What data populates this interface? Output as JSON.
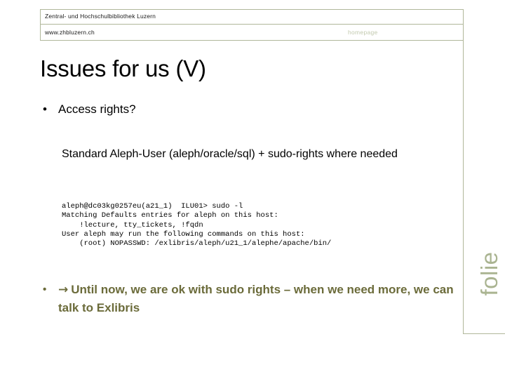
{
  "slide": {
    "title": "Issues for us (V)",
    "side_label": "folie"
  },
  "header": {
    "institution": "Zentral- und Hochschulbibliothek Luzern",
    "url": "www.zhbluzern.ch",
    "link_label": "homepage"
  },
  "content": {
    "bullet_1": {
      "marker": "•",
      "text": "Access rights?"
    },
    "sub_paragraph": "Standard Aleph-User (aleph/oracle/sql) + sudo-rights where needed",
    "code_block": "aleph@dc03kg0257eu(a21_1)  ILU01> sudo -l\nMatching Defaults entries for aleph on this host:\n    !lecture, tty_tickets, !fqdn\nUser aleph may run the following commands on this host:\n    (root) NOPASSWD: /exlibris/aleph/u21_1/alephe/apache/bin/",
    "bullet_2": {
      "marker": "•",
      "arrow": "→",
      "text": "Until now, we are ok with sudo rights – when we need more, we can talk to Exlibris"
    }
  },
  "colors": {
    "border": "#b0b79a",
    "accent_olive": "#6b6b3a",
    "side_label": "#aab491",
    "muted_link": "#c3caaf"
  }
}
